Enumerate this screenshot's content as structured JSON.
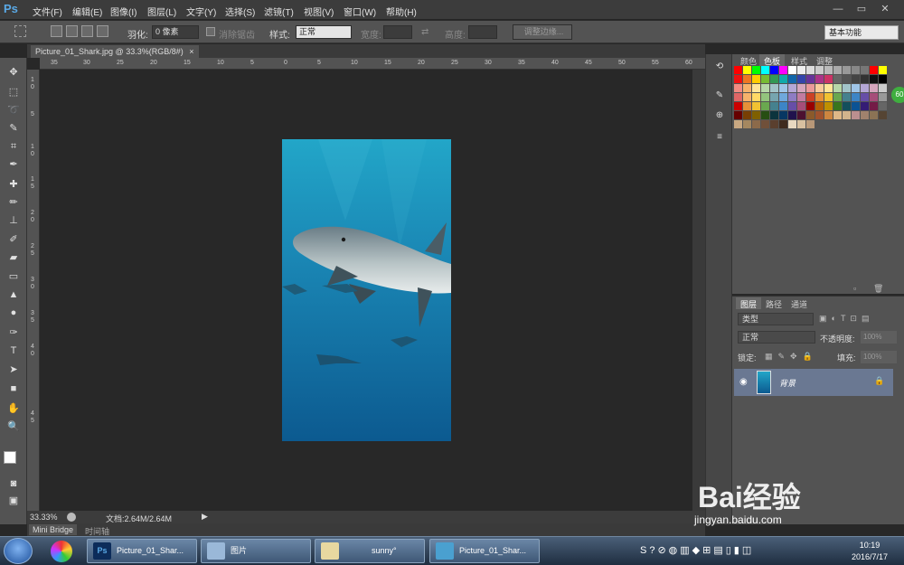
{
  "app": {
    "logo": "Ps"
  },
  "menu": [
    "文件(F)",
    "编辑(E)",
    "图像(I)",
    "图层(L)",
    "文字(Y)",
    "选择(S)",
    "滤镜(T)",
    "视图(V)",
    "窗口(W)",
    "帮助(H)"
  ],
  "window_controls": {
    "minimize": "—",
    "restore": "▭",
    "close": "✕"
  },
  "options": {
    "feather_label": "羽化:",
    "feather_value": "0 像素",
    "antialias_label": "消除锯齿",
    "style_label": "样式:",
    "style_value": "正常",
    "width_label": "宽度:",
    "height_label": "高度:",
    "refine_edge": "调整边缘...",
    "workspace": "基本功能"
  },
  "document": {
    "tab_title": "Picture_01_Shark.jpg @ 33.3%(RGB/8#)",
    "close": "×",
    "zoom": "33.33%",
    "doc_info": "文档:2.64M/2.64M"
  },
  "rulers": {
    "top": [
      "35",
      "30",
      "25",
      "20",
      "15",
      "10",
      "5",
      "0",
      "5",
      "10",
      "15",
      "20",
      "25",
      "30",
      "35",
      "40",
      "45",
      "50",
      "55",
      "60"
    ],
    "left": [
      "1",
      "0",
      "5",
      "1",
      "0",
      "1",
      "5",
      "2",
      "0",
      "2",
      "5",
      "3",
      "0",
      "3",
      "5",
      "4",
      "0",
      "4",
      "5"
    ]
  },
  "bottom_tabs": [
    "Mini Bridge",
    "时间轴"
  ],
  "swatches_panel": {
    "tabs": [
      "颜色",
      "色板",
      "样式",
      "调整"
    ],
    "active_tab": "色板"
  },
  "layers_panel": {
    "tabs": [
      "图层",
      "路径",
      "通道"
    ],
    "active_tab": "图层",
    "filter_label": "类型",
    "blend_mode": "正常",
    "opacity_label": "不透明度:",
    "opacity_value": "100%",
    "lock_label": "锁定:",
    "fill_label": "填充:",
    "fill_value": "100%",
    "layer_name": "背景"
  },
  "taskbar": {
    "items": [
      "Picture_01_Shar...",
      "图片",
      "sunny°",
      "Picture_01_Shar..."
    ],
    "time": "10:19",
    "date": "2016/7/17",
    "badge": "60"
  },
  "watermark": {
    "text": "Bai经验",
    "url": "jingyan.baidu.com"
  },
  "colors": {
    "accent": "#5aa9e6",
    "layer_selected": "#6a7892",
    "panel_bg": "#535353",
    "canvas_bg": "#282828",
    "ocean_light": "#1e9bc2",
    "ocean_dark": "#0d5a8c"
  }
}
